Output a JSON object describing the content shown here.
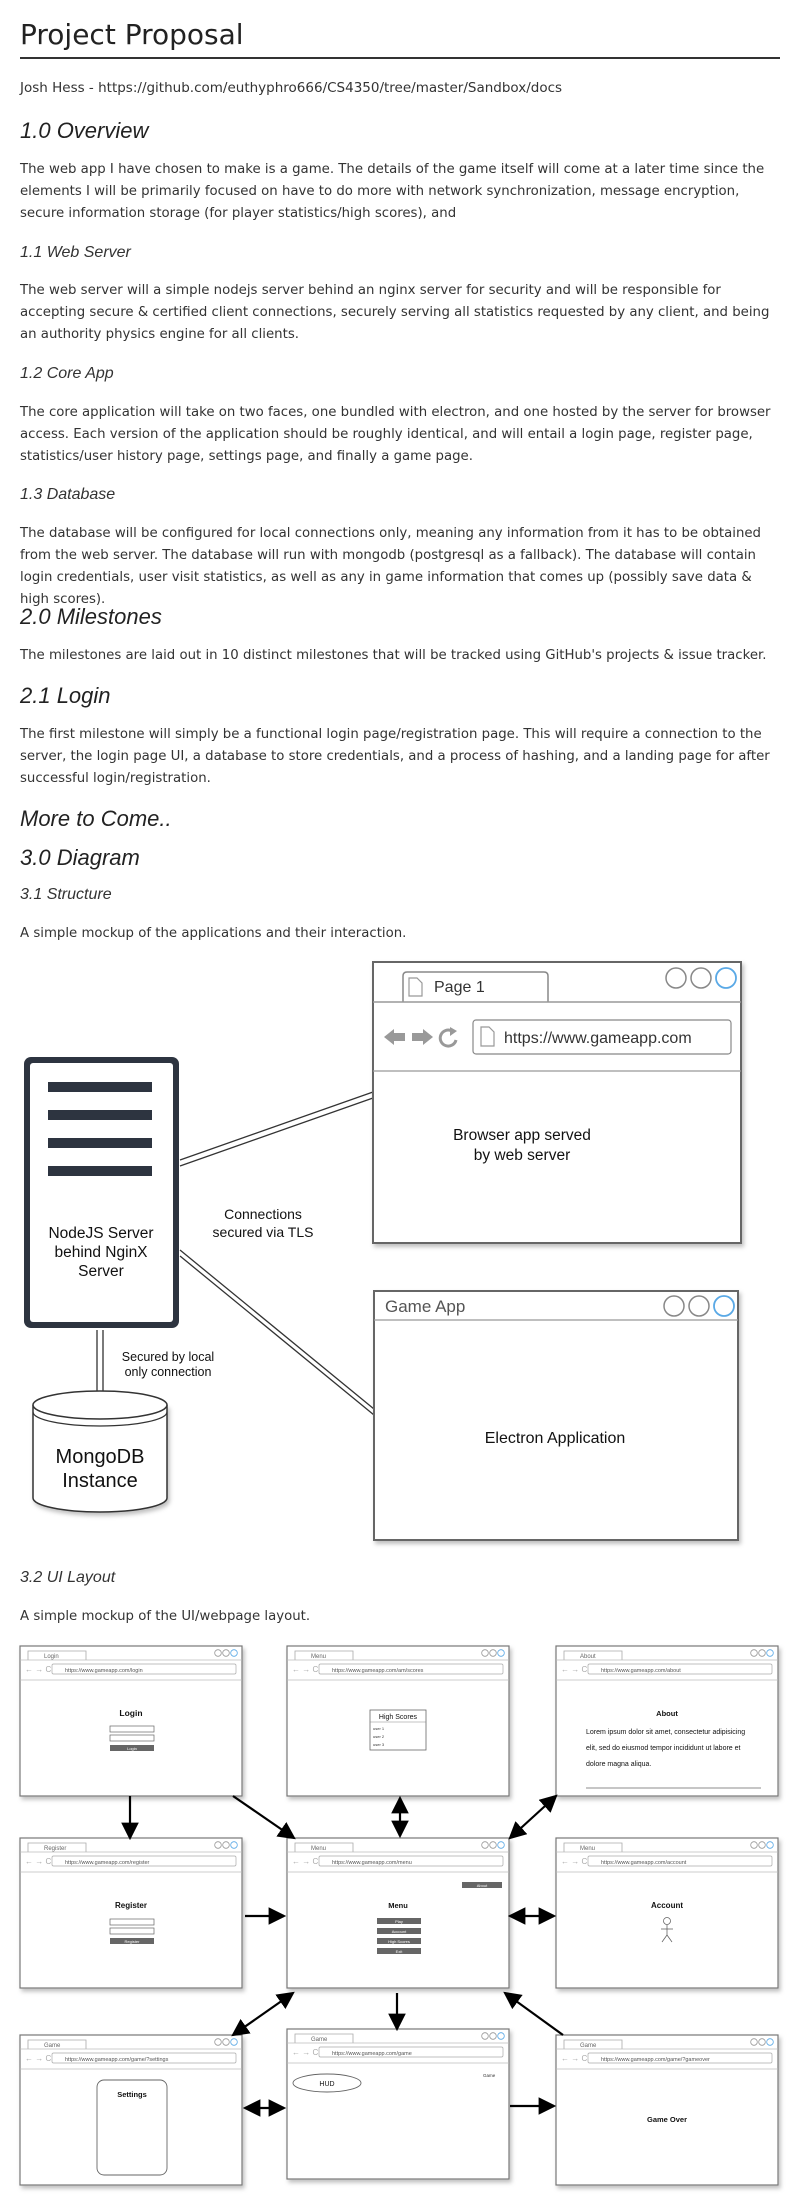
{
  "title": "Project Proposal",
  "author": "Josh Hess - https://github.com/euthyphro666/CS4350/tree/master/Sandbox/docs",
  "sections": {
    "overview": {
      "heading": "1.0 Overview",
      "text": "The web app I have chosen to make is a game. The details of the game itself will come at a later time since the elements I will be primarily focused on have to do more with network synchronization, message encryption, secure information storage (for player statistics/high scores), and"
    },
    "web_server": {
      "heading": "1.1 Web Server",
      "text": "The web server will a simple nodejs server behind an nginx server for security and will be responsible for accepting secure & certified client connections, securely serving all statistics requested by any client, and being an authority physics engine for all clients."
    },
    "core_app": {
      "heading": "1.2 Core App",
      "text": "The core application will take on two faces, one bundled with electron, and one hosted by the server for browser access. Each version of the application should be roughly identical, and will entail a login page, register page, statistics/user history page, settings page, and finally a game page."
    },
    "database": {
      "heading": "1.3 Database",
      "text": "The database will be configured for local connections only, meaning any information from it has to be obtained from the web server. The database will run with mongodb (postgresql as a fallback). The database will contain login credentials, user visit statistics, as well as any in game information that comes up (possibly save data & high scores)."
    },
    "milestones": {
      "heading": "2.0 Milestones",
      "text": "The milestones are laid out in 10 distinct milestones that will be tracked using GitHub's projects & issue tracker."
    },
    "login": {
      "heading": "2.1 Login",
      "text": "The first milestone will simply be a functional login page/registration page. This will require a connection to the server, the login page UI, a database to store credentials, and a process of hashing, and a landing page for after successful login/registration."
    },
    "more": {
      "heading": "More to Come.."
    },
    "diagram": {
      "heading": "3.0 Diagram"
    },
    "structure": {
      "heading": "3.1 Structure",
      "text": "A simple mockup of the applications and their interaction."
    },
    "ui_layout": {
      "heading": "3.2 UI Layout",
      "text": "A simple mockup of the UI/webpage layout."
    }
  },
  "structure_diagram": {
    "browser_tab": "Page 1",
    "browser_url": "https://www.gameapp.com",
    "browser_body_line1": "Browser app served",
    "browser_body_line2": "by web server",
    "server_line1": "NodeJS Server",
    "server_line2": "behind NginX",
    "server_line3": "Server",
    "connections_line1": "Connections",
    "connections_line2": "secured via TLS",
    "secured_line1": "Secured by local",
    "secured_line2": "only connection",
    "db_line1": "MongoDB",
    "db_line2": "Instance",
    "game_title": "Game App",
    "electron_label": "Electron Application"
  },
  "ui_diagram": {
    "login": {
      "tab": "Login",
      "url": "https://www.gameapp.com/login",
      "title": "Login",
      "button": "Login"
    },
    "scores": {
      "tab": "Menu",
      "url": "https://www.gameapp.com/am/scores",
      "title": "High Scores",
      "rows": [
        "user 1",
        "user 2",
        "user 3"
      ]
    },
    "about": {
      "tab": "About",
      "url": "https://www.gameapp.com/about",
      "title": "About",
      "lines": [
        "Lorem ipsum dolor sit amet, consectetur adipisicing",
        "elit, sed do eiusmod tempor incididunt ut labore et",
        "dolore magna aliqua."
      ]
    },
    "register": {
      "tab": "Register",
      "url": "https://www.gameapp.com/register",
      "title": "Register",
      "button": "Register"
    },
    "menu": {
      "tab": "Menu",
      "url": "https://www.gameapp.com/menu",
      "title": "Menu",
      "about_button": "About",
      "buttons": [
        "Play",
        "Account",
        "High Scores",
        "Exit"
      ]
    },
    "account": {
      "tab": "Menu",
      "url": "https://www.gameapp.com/account",
      "title": "Account"
    },
    "settings": {
      "tab": "Game",
      "url": "https://www.gameapp.com/game/?settings",
      "title": "Settings"
    },
    "game": {
      "tab": "Game",
      "url": "https://www.gameapp.com/game",
      "hud": "HUD",
      "corner": "Game"
    },
    "gameover": {
      "tab": "Game",
      "url": "https://www.gameapp.com/game/?gameover",
      "title": "Game Over"
    }
  },
  "colors": {
    "server_fill": "#2d3440",
    "window_border": "#666666",
    "accent_circle": "#5aa9e6",
    "arrow": "#000000"
  }
}
